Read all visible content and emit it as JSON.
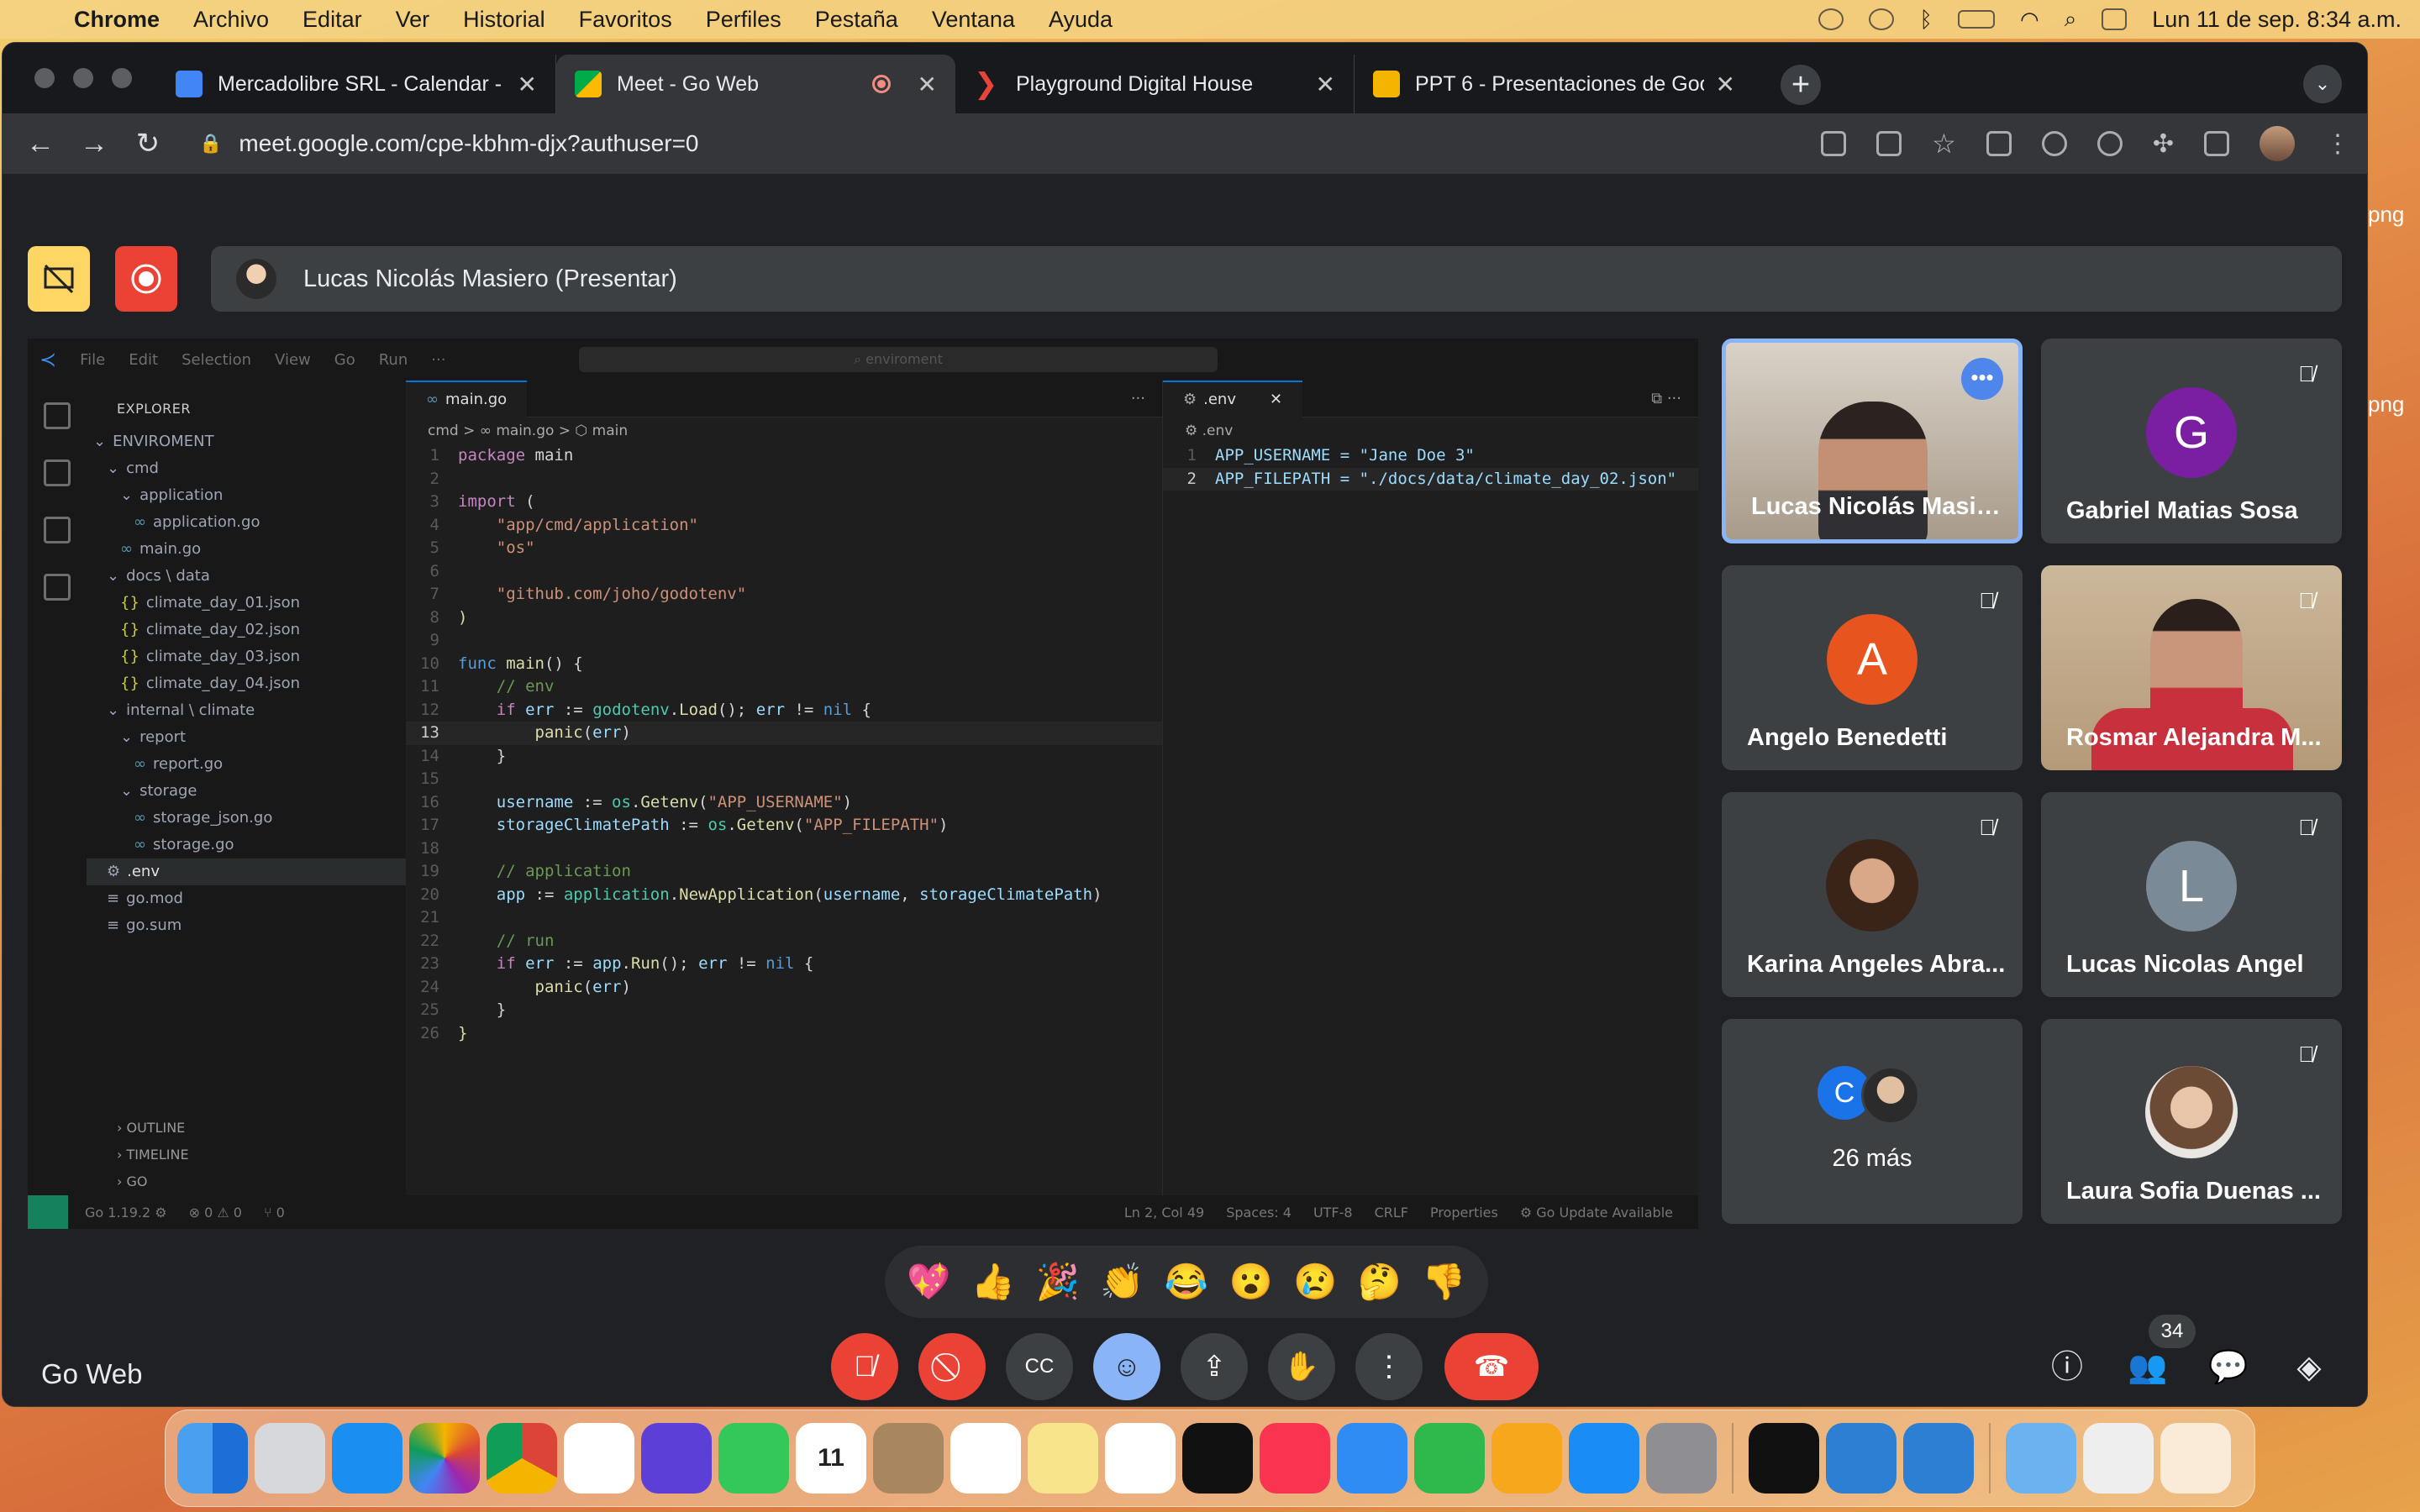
{
  "menubar": {
    "app": "Chrome",
    "items": [
      "Archivo",
      "Editar",
      "Ver",
      "Historial",
      "Favoritos",
      "Perfiles",
      "Pestaña",
      "Ventana",
      "Ayuda"
    ],
    "clock": "Lun 11 de sep.  8:34 a.m."
  },
  "browser": {
    "tabs": [
      {
        "title": "Mercadolibre SRL - Calendar -",
        "favicon_color": "#4285f4"
      },
      {
        "title": "Meet - Go Web",
        "favicon_color": "#00ac47"
      },
      {
        "title": "Playground Digital House",
        "favicon_color": "#e8443a"
      },
      {
        "title": "PPT 6 - Presentaciones de Goo",
        "favicon_color": "#f4b400"
      }
    ],
    "url_domain": "meet.google.com",
    "url_path": "/cpe-kbhm-djx?authuser=0"
  },
  "meet": {
    "presenter_label": "Lucas Nicolás Masiero (Presentar)",
    "meeting_name": "Go Web",
    "participants_count": "34",
    "reactions": [
      "💖",
      "👍",
      "🎉",
      "👏",
      "😂",
      "😮",
      "😢",
      "🤔",
      "👎"
    ],
    "tiles": [
      {
        "name": "Lucas Nicolás Masie...",
        "kind": "video",
        "speaking": true
      },
      {
        "name": "Gabriel Matias Sosa",
        "kind": "initial",
        "initial": "G",
        "color": "#7b1fa2"
      },
      {
        "name": "Angelo Benedetti",
        "kind": "initial",
        "initial": "A",
        "color": "#e8541e"
      },
      {
        "name": "Rosmar Alejandra M...",
        "kind": "video"
      },
      {
        "name": "Karina Angeles Abra...",
        "kind": "photo"
      },
      {
        "name": "Lucas Nicolas Angel",
        "kind": "initial",
        "initial": "L",
        "color": "#7b8a97"
      },
      {
        "name": "26 más",
        "kind": "more",
        "initial": "C"
      },
      {
        "name": "Laura Sofia Duenas ...",
        "kind": "photo"
      }
    ]
  },
  "vscode": {
    "menu": [
      "File",
      "Edit",
      "Selection",
      "View",
      "Go",
      "Run",
      "···"
    ],
    "search": "enviroment",
    "explorer_title": "EXPLORER",
    "tree": [
      {
        "label": "ENVIROMENT",
        "indent": 0,
        "icon": "⌄"
      },
      {
        "label": "cmd",
        "indent": 1,
        "icon": "⌄"
      },
      {
        "label": "application",
        "indent": 2,
        "icon": "⌄"
      },
      {
        "label": "application.go",
        "indent": 3,
        "icon": "∞"
      },
      {
        "label": "main.go",
        "indent": 2,
        "icon": "∞"
      },
      {
        "label": "docs \\ data",
        "indent": 1,
        "icon": "⌄"
      },
      {
        "label": "climate_day_01.json",
        "indent": 2,
        "icon": "{}"
      },
      {
        "label": "climate_day_02.json",
        "indent": 2,
        "icon": "{}"
      },
      {
        "label": "climate_day_03.json",
        "indent": 2,
        "icon": "{}"
      },
      {
        "label": "climate_day_04.json",
        "indent": 2,
        "icon": "{}"
      },
      {
        "label": "internal \\ climate",
        "indent": 1,
        "icon": "⌄"
      },
      {
        "label": "report",
        "indent": 2,
        "icon": "⌄"
      },
      {
        "label": "report.go",
        "indent": 3,
        "icon": "∞"
      },
      {
        "label": "storage",
        "indent": 2,
        "icon": "⌄"
      },
      {
        "label": "storage_json.go",
        "indent": 3,
        "icon": "∞"
      },
      {
        "label": "storage.go",
        "indent": 3,
        "icon": "∞"
      },
      {
        "label": ".env",
        "indent": 1,
        "icon": "⚙",
        "selected": true
      },
      {
        "label": "go.mod",
        "indent": 1,
        "icon": "≡"
      },
      {
        "label": "go.sum",
        "indent": 1,
        "icon": "≡"
      }
    ],
    "outline": [
      "OUTLINE",
      "TIMELINE",
      "GO"
    ],
    "tab1": "main.go",
    "crumbs": "cmd > ∞ main.go > ⬡ main",
    "tab2": ".env",
    "crumbs2": "⚙ .env",
    "current_line": 13,
    "env_lines": [
      "APP_USERNAME = \"Jane Doe 3\"",
      "APP_FILEPATH = \"./docs/data/climate_day_02.json\""
    ],
    "status_left": [
      "Go 1.19.2 ⚙",
      "⊗ 0 ⚠ 0",
      "⑂ 0"
    ],
    "status_right": [
      "Ln 2, Col 49",
      "Spaces: 4",
      "UTF-8",
      "CRLF",
      "Properties",
      "⚙ Go Update Available"
    ]
  }
}
